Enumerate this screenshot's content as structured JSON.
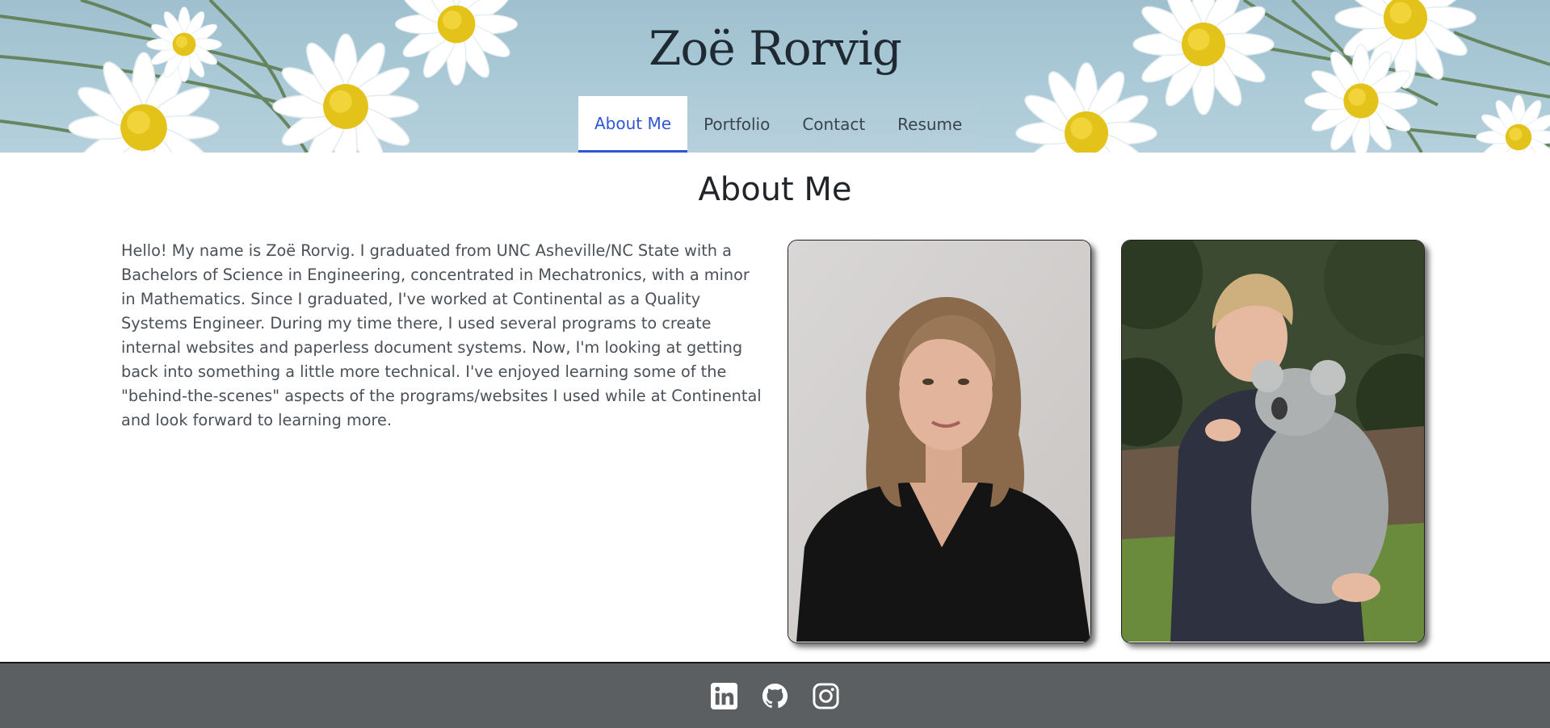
{
  "header": {
    "site_title": "Zoë Rorvig",
    "nav": [
      {
        "label": "About Me",
        "active": true
      },
      {
        "label": "Portfolio",
        "active": false
      },
      {
        "label": "Contact",
        "active": false
      },
      {
        "label": "Resume",
        "active": false
      }
    ]
  },
  "main": {
    "heading": "About Me",
    "bio": "Hello! My name is Zoë Rorvig. I graduated from UNC Asheville/NC State with a Bachelors of Science in Engineering, concentrated in Mechatronics, with a minor in Mathematics. Since I graduated, I've worked at Continental as a Quality Systems Engineer. During my time there, I used several programs to create internal websites and paperless document systems. Now, I'm looking at getting back into something a little more technical. I've enjoyed learning some of the \"behind-the-scenes\" aspects of the programs/websites I used while at Continental and look forward to learning more.",
    "photos": [
      {
        "subject": "portrait-photo"
      },
      {
        "subject": "koala-photo"
      }
    ]
  },
  "footer": {
    "icons": [
      "linkedin-icon",
      "github-icon",
      "instagram-icon"
    ]
  },
  "colors": {
    "accent": "#2f55d4",
    "footer_bg": "#5b5f62",
    "banner_sky": "#a9c8d6"
  }
}
